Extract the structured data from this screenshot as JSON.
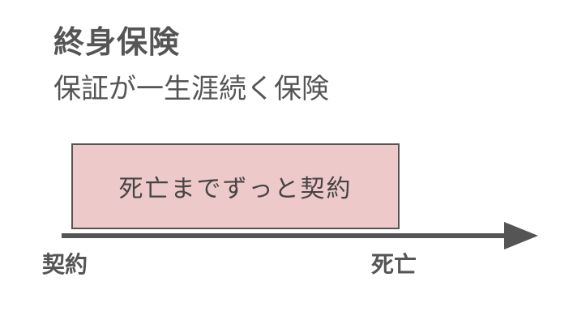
{
  "title": "終身保険",
  "subtitle": "保証が一生涯続く保険",
  "period_label": "死亡までずっと契約",
  "timeline": {
    "start_label": "契約",
    "end_label": "死亡"
  },
  "colors": {
    "text": "#555555",
    "box_fill": "#edc9c9",
    "arrow": "#555555"
  }
}
